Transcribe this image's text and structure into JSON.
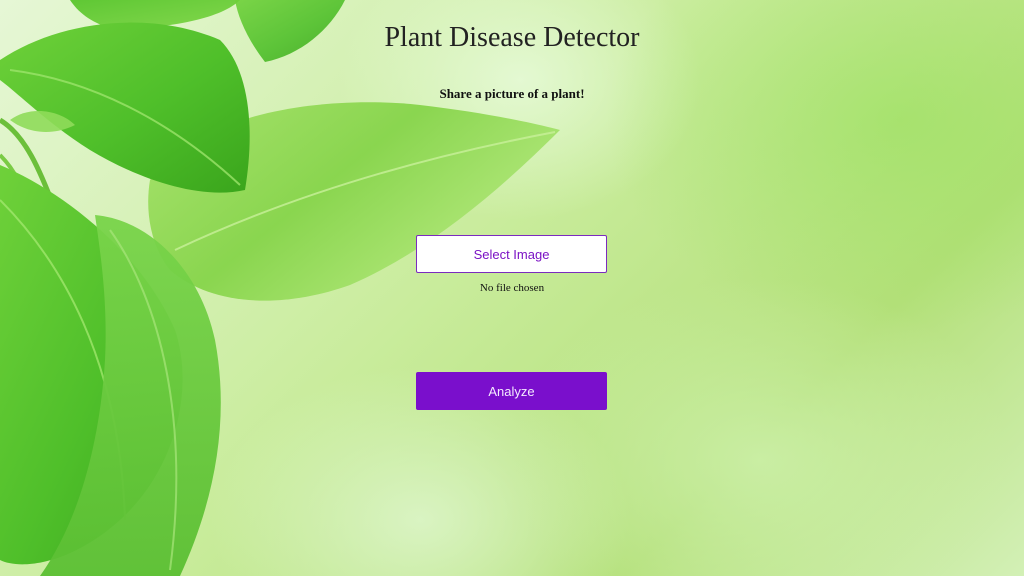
{
  "page": {
    "title": "Plant Disease Detector",
    "subtitle": "Share a picture of a plant!"
  },
  "upload": {
    "select_label": "Select Image",
    "file_status": "No file chosen"
  },
  "actions": {
    "analyze_label": "Analyze"
  },
  "colors": {
    "accent": "#7a0fcc",
    "select_text": "#7a12c4",
    "leaf_dark": "#3fae1f",
    "leaf_light": "#8fdc4a"
  },
  "background": {
    "image_subject": "green-leaves"
  }
}
